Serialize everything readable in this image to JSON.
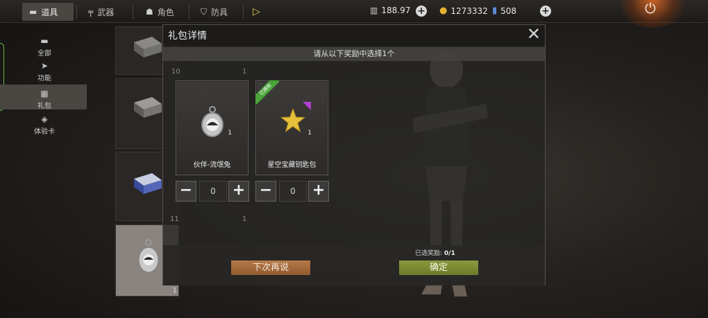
{
  "tabs": [
    {
      "label": "道具",
      "icon": "item-icon",
      "active": true
    },
    {
      "label": "武器",
      "icon": "gun-icon",
      "active": false
    },
    {
      "label": "角色",
      "icon": "character-icon",
      "active": false
    },
    {
      "label": "防具",
      "icon": "shield-icon",
      "active": false
    }
  ],
  "currencies": {
    "energy": "188.97",
    "coins": "1273332",
    "tickets": "508"
  },
  "categories": [
    {
      "label": "全部",
      "icon": "all-icon"
    },
    {
      "label": "功能",
      "icon": "function-icon"
    },
    {
      "label": "礼包",
      "icon": "gift-icon",
      "active": true
    },
    {
      "label": "体验卡",
      "icon": "card-icon"
    }
  ],
  "inventory": {
    "selected_count": "1"
  },
  "modal": {
    "title": "礼包详情",
    "instruction": "请从以下奖励中选择1个",
    "ghost_numbers": [
      "10",
      "1",
      "11",
      "1"
    ],
    "rewards": [
      {
        "name": "伙伴-流氓兔",
        "count": "1",
        "quantity": "0",
        "owned": false,
        "icon": "dog-tag-icon"
      },
      {
        "name": "星空宝藏钥匙包",
        "count": "1",
        "quantity": "0",
        "owned": true,
        "owned_label": "已拥有",
        "icon": "star-icon"
      }
    ],
    "selected_label": "已选奖励:",
    "selected_value": "0/1",
    "later_button": "下次再说",
    "confirm_button": "确定"
  },
  "colors": {
    "confirm": "#7c8c35",
    "later": "#a26a3c",
    "owned_ribbon": "#4aa43a",
    "rarity_purple": "#b23fd6"
  }
}
